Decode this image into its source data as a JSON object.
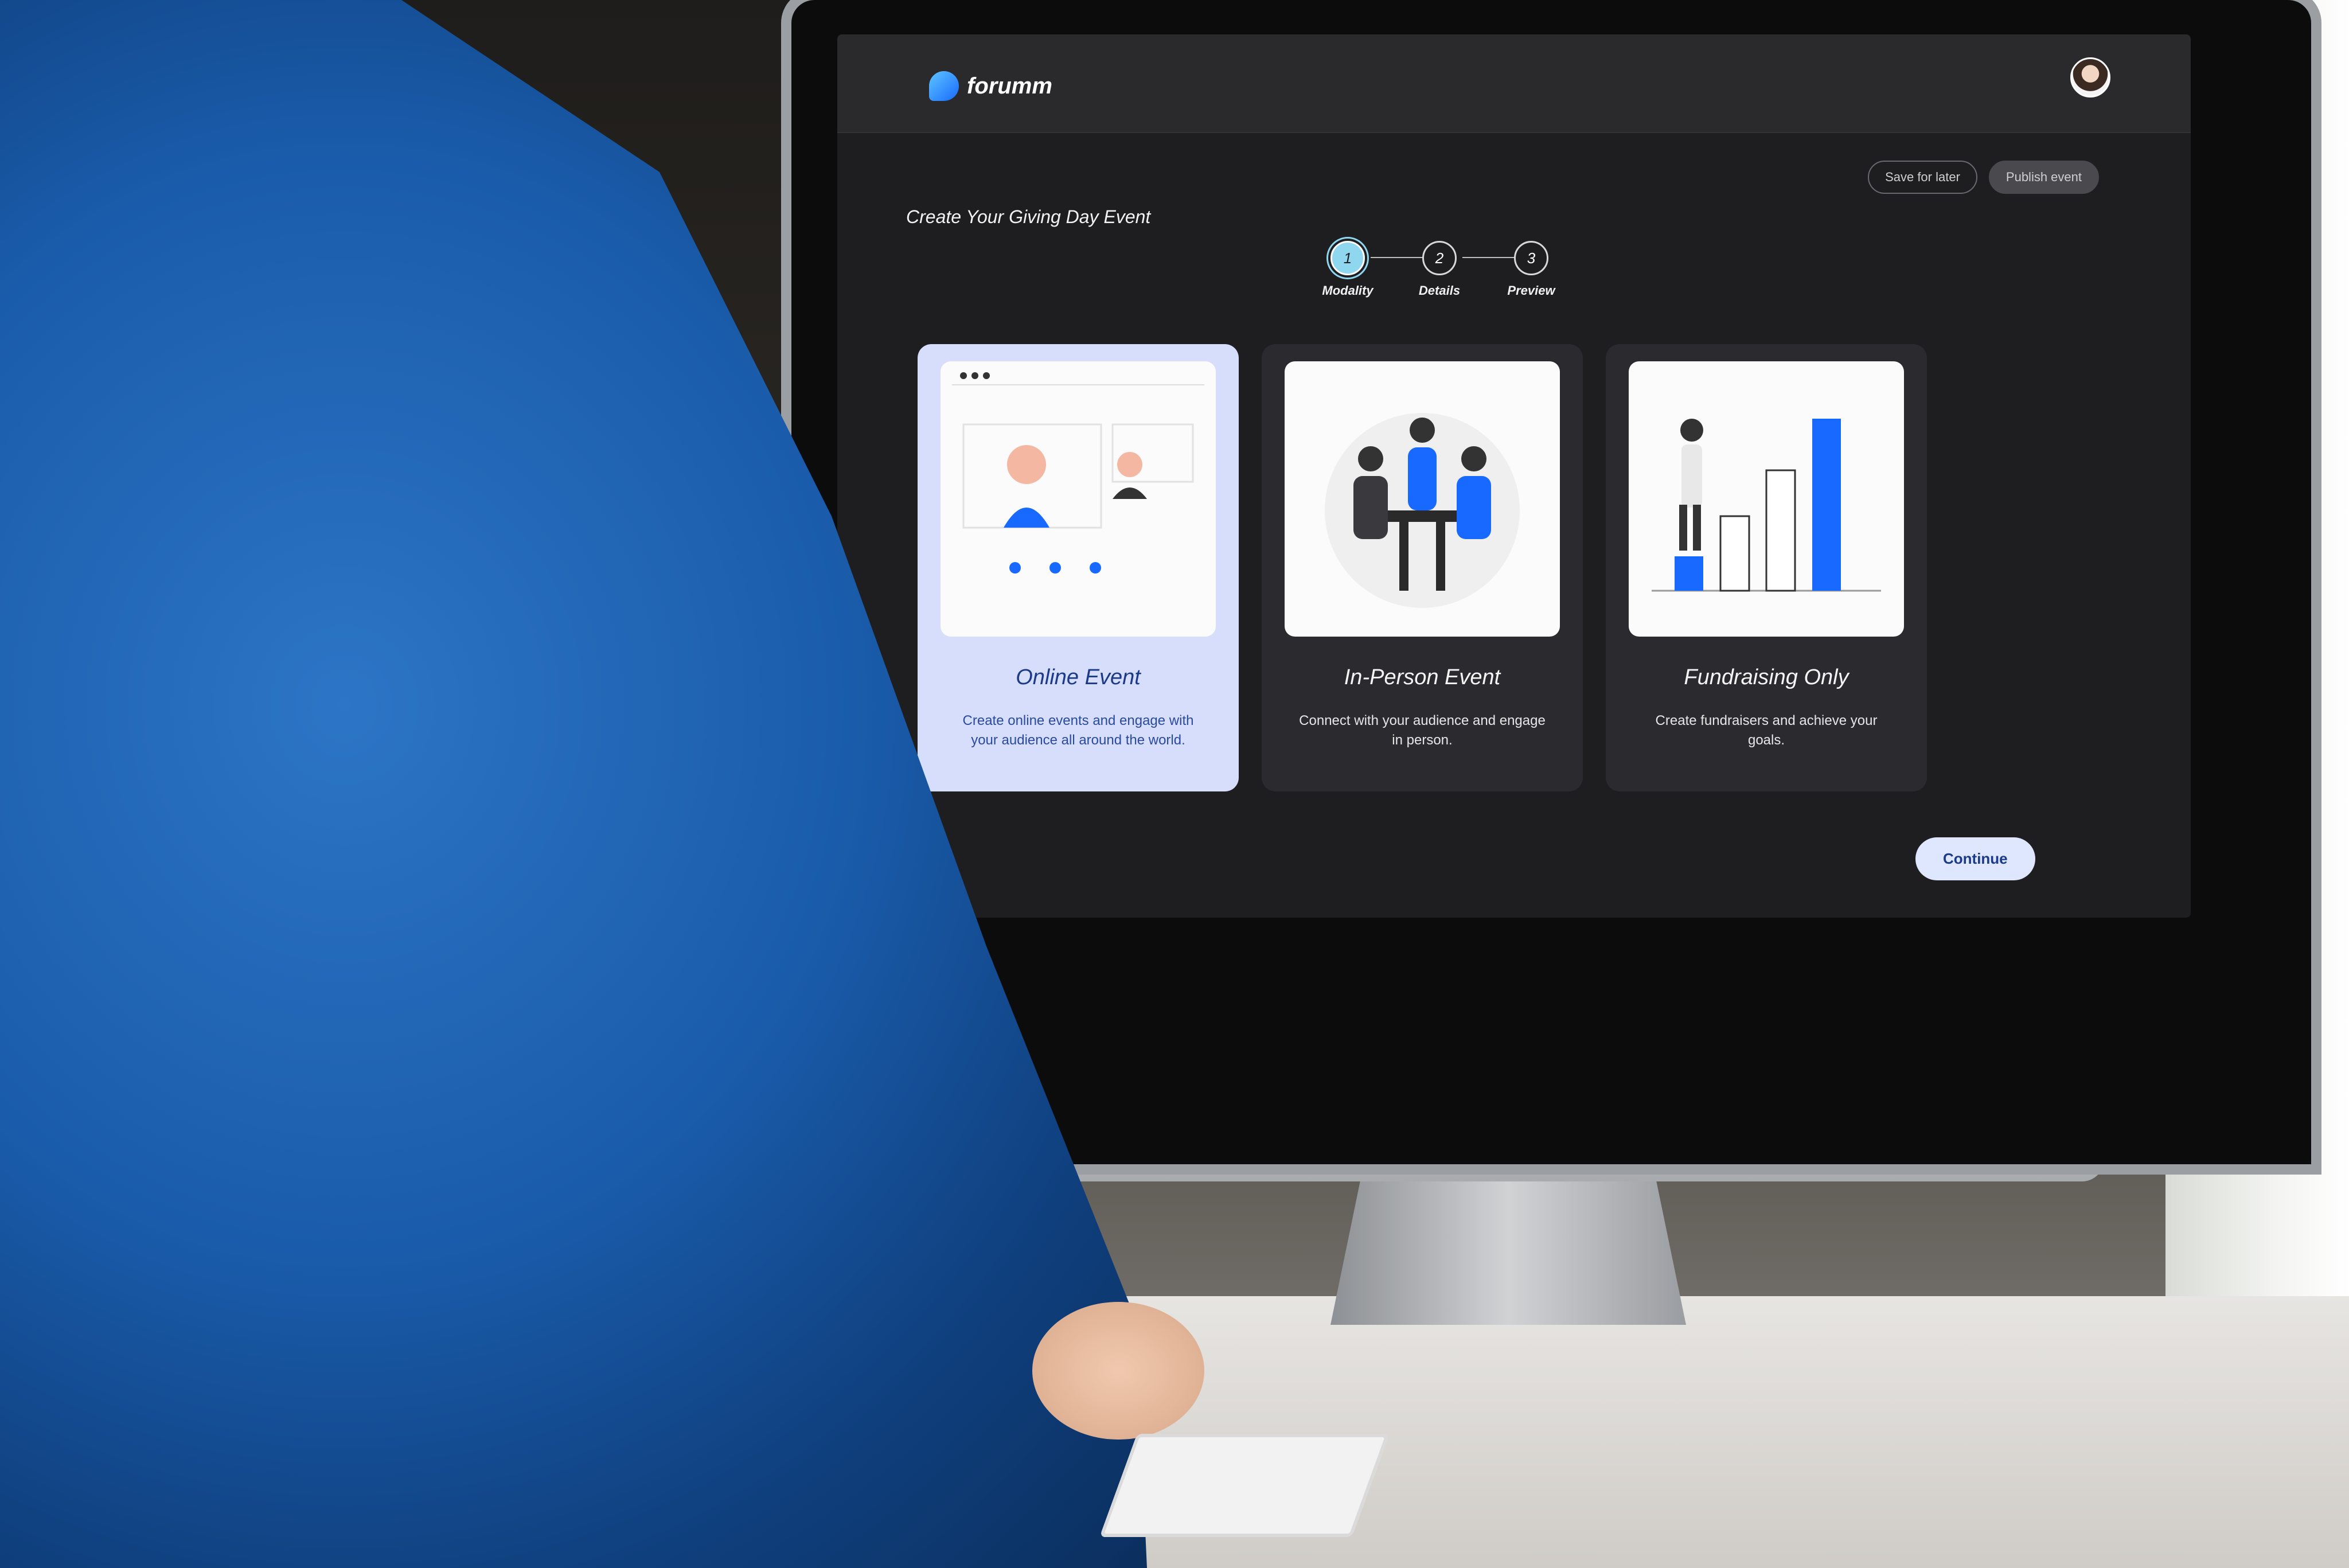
{
  "app": {
    "brand_name": "forumm",
    "accent_color": "#1769ff",
    "selected_card_color": "#d6defb"
  },
  "header": {
    "save_label": "Save for later",
    "publish_label": "Publish event"
  },
  "page": {
    "title": "Create Your Giving Day Event"
  },
  "stepper": {
    "steps": [
      {
        "number": "1",
        "label": "Modality",
        "active": true
      },
      {
        "number": "2",
        "label": "Details",
        "active": false
      },
      {
        "number": "3",
        "label": "Preview",
        "active": false
      }
    ]
  },
  "options": [
    {
      "title": "Online Event",
      "description": "Create online events and engage with your audience all around the world.",
      "selected": true,
      "icon": "video-call-illustration"
    },
    {
      "title": "In-Person Event",
      "description": "Connect with your audience and engage in person.",
      "selected": false,
      "icon": "meeting-illustration"
    },
    {
      "title": "Fundraising Only",
      "description": "Create fundraisers and achieve your goals.",
      "selected": false,
      "icon": "growth-chart-illustration"
    }
  ],
  "actions": {
    "continue_label": "Continue"
  }
}
